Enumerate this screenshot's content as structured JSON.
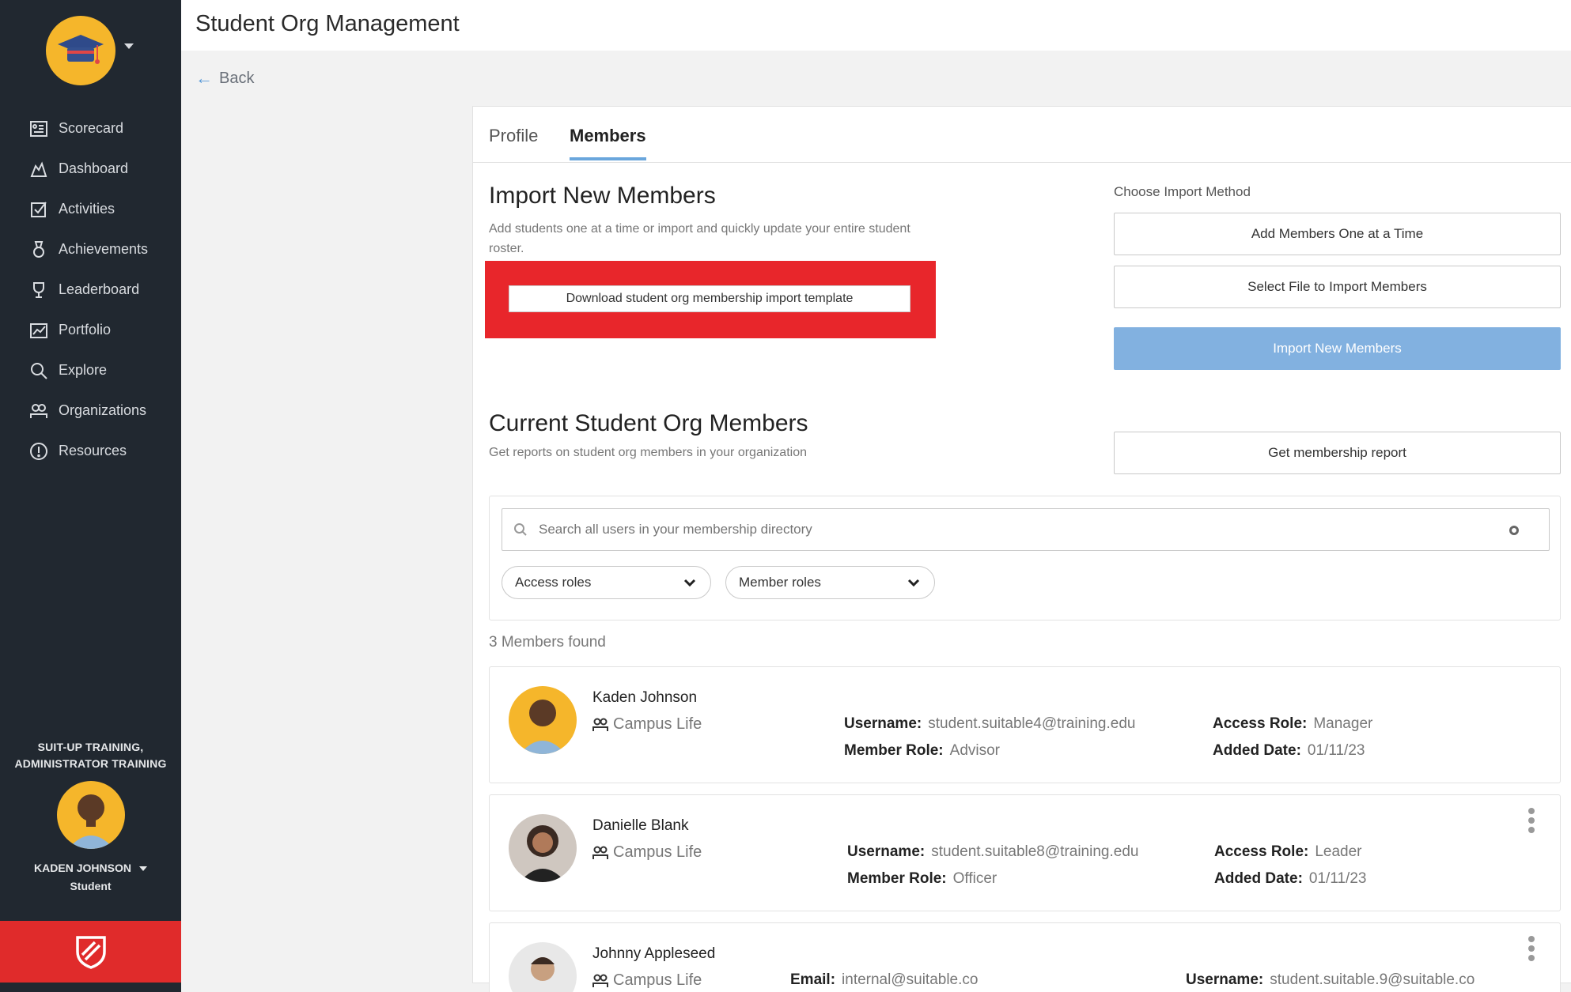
{
  "header": {
    "title": "Student Org Management"
  },
  "back_label": "Back",
  "sidebar": {
    "items": [
      {
        "label": "Scorecard",
        "icon": "scorecard-icon"
      },
      {
        "label": "Dashboard",
        "icon": "dashboard-icon"
      },
      {
        "label": "Activities",
        "icon": "activities-icon"
      },
      {
        "label": "Achievements",
        "icon": "achievements-icon"
      },
      {
        "label": "Leaderboard",
        "icon": "leaderboard-icon"
      },
      {
        "label": "Portfolio",
        "icon": "portfolio-icon"
      },
      {
        "label": "Explore",
        "icon": "explore-icon"
      },
      {
        "label": "Organizations",
        "icon": "organizations-icon"
      },
      {
        "label": "Resources",
        "icon": "resources-icon"
      }
    ],
    "org_line1": "SUIT-UP TRAINING,",
    "org_line2": "ADMINISTRATOR TRAINING",
    "user_name": "KADEN JOHNSON",
    "user_role": "Student"
  },
  "tabs": [
    {
      "label": "Profile",
      "active": false
    },
    {
      "label": "Members",
      "active": true
    }
  ],
  "import": {
    "title": "Import New Members",
    "subtitle": "Add students one at a time or import and quickly update your entire student roster.",
    "download_label": "Download student org membership import template",
    "choose_label": "Choose Import Method",
    "add_one_label": "Add Members One at a Time",
    "select_file_label": "Select File to Import Members",
    "import_button_label": "Import New Members"
  },
  "current": {
    "title": "Current Student Org Members",
    "subtitle": "Get reports on student org members in your organization",
    "report_label": "Get membership report",
    "search_placeholder": "Search all users in your membership directory",
    "access_roles_label": "Access roles",
    "member_roles_label": "Member roles",
    "found_text": "3 Members found"
  },
  "members": [
    {
      "name": "Kaden Johnson",
      "org": "Campus Life",
      "f1_label": "Username:",
      "f1_value": "student.suitable4@training.edu",
      "f2_label": "Member Role:",
      "f2_value": "Advisor",
      "f3_label": "Access Role:",
      "f3_value": "Manager",
      "f4_label": "Added Date:",
      "f4_value": "01/11/23"
    },
    {
      "name": "Danielle Blank",
      "org": "Campus Life",
      "f1_label": "Username:",
      "f1_value": "student.suitable8@training.edu",
      "f2_label": "Member Role:",
      "f2_value": "Officer",
      "f3_label": "Access Role:",
      "f3_value": "Leader",
      "f4_label": "Added Date:",
      "f4_value": "01/11/23"
    },
    {
      "name": "Johnny Appleseed",
      "org": "Campus Life",
      "f1_label": "Email:",
      "f1_value": "internal@suitable.co",
      "f3_label": "Username:",
      "f3_value": "student.suitable.9@suitable.co"
    }
  ],
  "colors": {
    "sidebar_bg": "#212830",
    "accent_blue": "#6aa6dc",
    "primary_button": "#82b1e0",
    "highlight_red": "#e8262b",
    "footer_red": "#e02b2b",
    "avatar_yellow": "#f5b62b"
  }
}
